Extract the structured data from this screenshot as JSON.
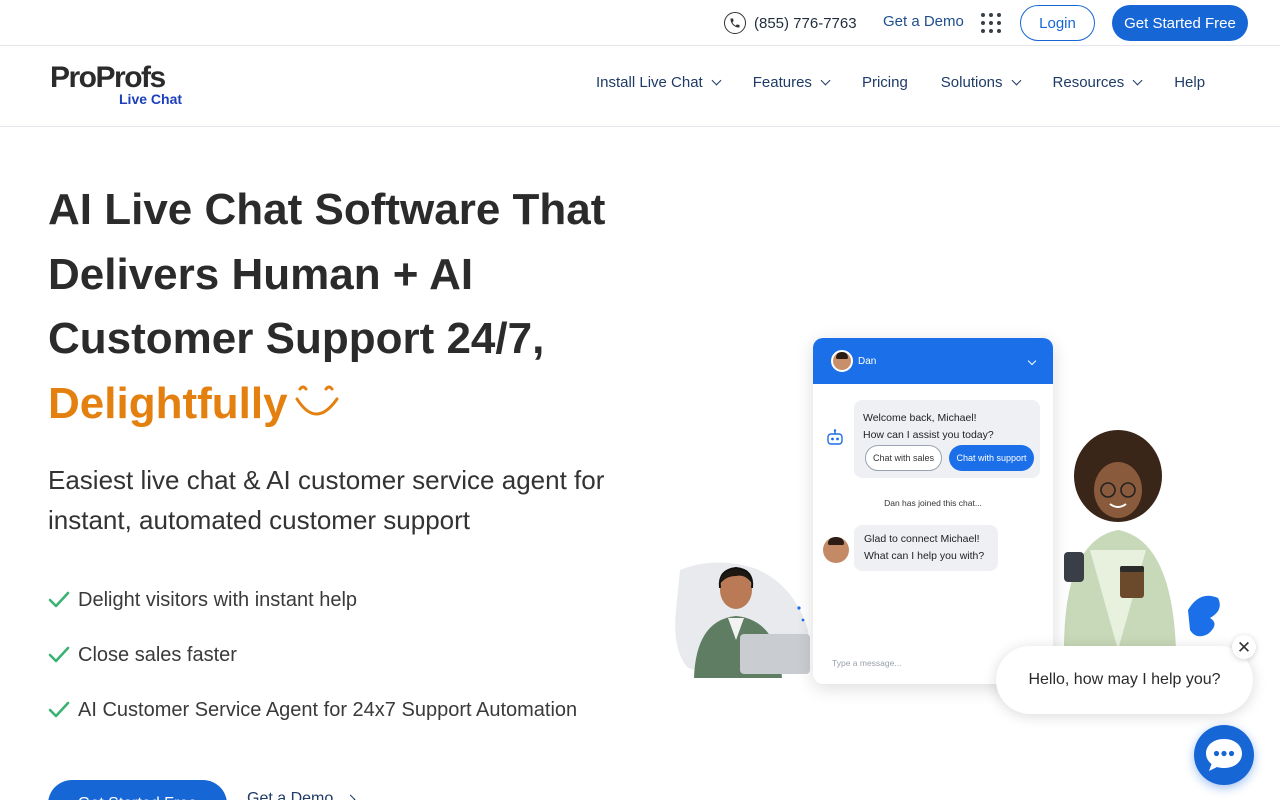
{
  "topbar": {
    "phone": "(855) 776-7763",
    "demo_link": "Get a Demo",
    "login": "Login",
    "get_started": "Get Started Free"
  },
  "logo": {
    "line1": "ProProfs",
    "line2": "Live Chat"
  },
  "nav": {
    "items": [
      {
        "label": "Install Live Chat",
        "has_dropdown": true
      },
      {
        "label": "Features",
        "has_dropdown": true
      },
      {
        "label": "Pricing",
        "has_dropdown": false
      },
      {
        "label": "Solutions",
        "has_dropdown": true
      },
      {
        "label": "Resources",
        "has_dropdown": true
      },
      {
        "label": "Help",
        "has_dropdown": false
      }
    ]
  },
  "hero": {
    "title_lines": [
      "AI Live Chat Software That",
      "Delivers Human + AI",
      "Customer Support 24/7,"
    ],
    "title_accent": "Delightfully",
    "subtitle": "Easiest live chat & AI customer service agent for instant, automated customer support",
    "features": [
      "Delight visitors with instant help",
      "Close sales faster",
      "AI Customer Service Agent for 24x7 Support Automation"
    ],
    "cta_primary": "Get Started Free",
    "cta_secondary": "Get a Demo"
  },
  "chat_widget": {
    "agent_name": "Dan",
    "bot_message_line1": "Welcome back, Michael!",
    "bot_message_line2": "How can I assist you today?",
    "chip_sales": "Chat with sales",
    "chip_support": "Chat with support",
    "joined_notice": "Dan has joined this chat...",
    "agent_message_line1": "Glad to connect Michael!",
    "agent_message_line2": "What can I help you with?",
    "input_placeholder": "Type a message..."
  },
  "greeting": {
    "text": "Hello, how may I help you?",
    "close_symbol": "✕"
  },
  "colors": {
    "primary": "#1766d6",
    "accent": "#e4800f",
    "nav_text": "#1f3b66",
    "check": "#3bb273"
  },
  "icons": [
    "phone-icon",
    "apps-grid-icon",
    "chevron-down-icon",
    "check-icon",
    "smile-icon",
    "bot-icon",
    "close-icon",
    "chat-bubble-icon"
  ]
}
